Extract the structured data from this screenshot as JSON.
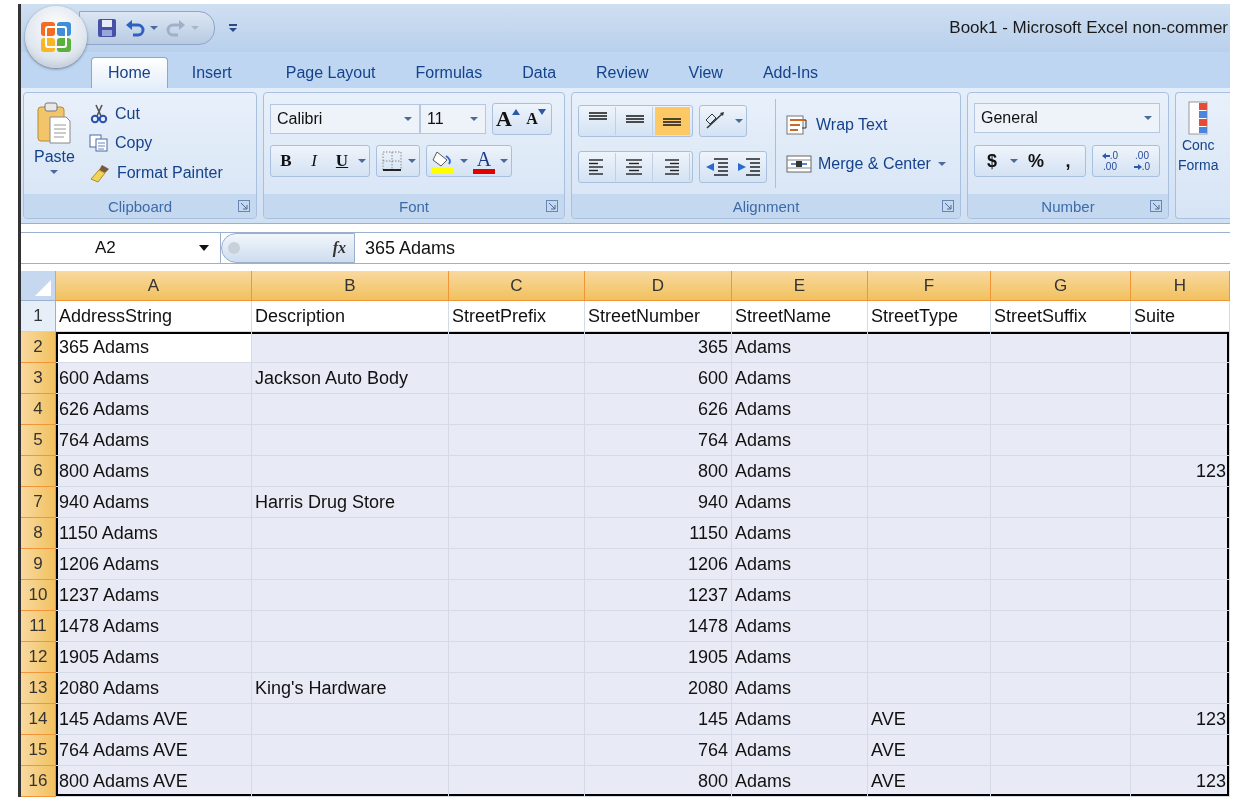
{
  "window": {
    "title": "Book1  -  Microsoft Excel non-commer"
  },
  "tabs": [
    {
      "label": "Home",
      "selected": true
    },
    {
      "label": "Insert",
      "selected": false
    },
    {
      "label": "Page Layout",
      "selected": false
    },
    {
      "label": "Formulas",
      "selected": false
    },
    {
      "label": "Data",
      "selected": false
    },
    {
      "label": "Review",
      "selected": false
    },
    {
      "label": "View",
      "selected": false
    },
    {
      "label": "Add-Ins",
      "selected": false
    }
  ],
  "ribbon": {
    "clipboard": {
      "label": "Clipboard",
      "paste": "Paste",
      "cut": "Cut",
      "copy": "Copy",
      "format_painter": "Format Painter"
    },
    "font": {
      "label": "Font",
      "font_name": "Calibri",
      "font_size": "11",
      "grow": "A",
      "shrink": "A",
      "bold": "B",
      "italic": "I",
      "underline": "U",
      "font_color": "A"
    },
    "alignment": {
      "label": "Alignment",
      "wrap_text": "Wrap Text",
      "merge_center": "Merge & Center",
      "vertical": [
        {
          "kind": "top",
          "selected": false
        },
        {
          "kind": "middle",
          "selected": false
        },
        {
          "kind": "bottom",
          "selected": true
        }
      ],
      "horizontal": [
        {
          "kind": "left",
          "selected": false
        },
        {
          "kind": "center",
          "selected": false
        },
        {
          "kind": "right",
          "selected": false
        }
      ]
    },
    "number": {
      "label": "Number",
      "format": "General",
      "currency": "$",
      "percent": "%",
      "comma": ",",
      "increase_decimal": [
        ".0",
        ".00"
      ],
      "decrease_decimal": [
        ".00",
        ".0"
      ]
    },
    "styles": {
      "conditional_formatting": [
        "Conc",
        "Forma"
      ]
    }
  },
  "formula_bar": {
    "name_box": "A2",
    "fx": "fx",
    "value": "365 Adams"
  },
  "sheet": {
    "columns": [
      {
        "letter": "A",
        "selected": true,
        "kind": "text"
      },
      {
        "letter": "B",
        "selected": true,
        "kind": "text"
      },
      {
        "letter": "C",
        "selected": true,
        "kind": "text"
      },
      {
        "letter": "D",
        "selected": true,
        "kind": "number"
      },
      {
        "letter": "E",
        "selected": true,
        "kind": "text"
      },
      {
        "letter": "F",
        "selected": true,
        "kind": "text"
      },
      {
        "letter": "G",
        "selected": true,
        "kind": "text"
      },
      {
        "letter": "H",
        "selected": true,
        "kind": "number"
      }
    ],
    "first_row": {
      "number": "1",
      "selected": false,
      "cells": [
        "AddressString",
        "Description",
        "StreetPrefix",
        "StreetNumber",
        "StreetName",
        "StreetType",
        "StreetSuffix",
        "Suite"
      ]
    },
    "rows": [
      {
        "number": "2",
        "selected": true,
        "active_first_cell": true,
        "cells": [
          "365 Adams",
          null,
          null,
          "365",
          "Adams",
          null,
          null,
          null
        ]
      },
      {
        "number": "3",
        "selected": true,
        "active_first_cell": false,
        "cells": [
          "600 Adams",
          "Jackson Auto Body",
          null,
          "600",
          "Adams",
          null,
          null,
          null
        ]
      },
      {
        "number": "4",
        "selected": true,
        "active_first_cell": false,
        "cells": [
          "626 Adams",
          null,
          null,
          "626",
          "Adams",
          null,
          null,
          null
        ]
      },
      {
        "number": "5",
        "selected": true,
        "active_first_cell": false,
        "cells": [
          "764 Adams",
          null,
          null,
          "764",
          "Adams",
          null,
          null,
          null
        ]
      },
      {
        "number": "6",
        "selected": true,
        "active_first_cell": false,
        "cells": [
          "800 Adams",
          null,
          null,
          "800",
          "Adams",
          null,
          null,
          "123"
        ]
      },
      {
        "number": "7",
        "selected": true,
        "active_first_cell": false,
        "cells": [
          "940 Adams",
          "Harris Drug Store",
          null,
          "940",
          "Adams",
          null,
          null,
          null
        ]
      },
      {
        "number": "8",
        "selected": true,
        "active_first_cell": false,
        "cells": [
          "1150 Adams",
          null,
          null,
          "1150",
          "Adams",
          null,
          null,
          null
        ]
      },
      {
        "number": "9",
        "selected": true,
        "active_first_cell": false,
        "cells": [
          "1206 Adams",
          null,
          null,
          "1206",
          "Adams",
          null,
          null,
          null
        ]
      },
      {
        "number": "10",
        "selected": true,
        "active_first_cell": false,
        "cells": [
          "1237 Adams",
          null,
          null,
          "1237",
          "Adams",
          null,
          null,
          null
        ]
      },
      {
        "number": "11",
        "selected": true,
        "active_first_cell": false,
        "cells": [
          "1478 Adams",
          null,
          null,
          "1478",
          "Adams",
          null,
          null,
          null
        ]
      },
      {
        "number": "12",
        "selected": true,
        "active_first_cell": false,
        "cells": [
          "1905 Adams",
          null,
          null,
          "1905",
          "Adams",
          null,
          null,
          null
        ]
      },
      {
        "number": "13",
        "selected": true,
        "active_first_cell": false,
        "cells": [
          "2080 Adams",
          "King's Hardware",
          null,
          "2080",
          "Adams",
          null,
          null,
          null
        ]
      },
      {
        "number": "14",
        "selected": true,
        "active_first_cell": false,
        "cells": [
          "145 Adams AVE",
          null,
          null,
          "145",
          "Adams",
          "AVE",
          null,
          "123"
        ]
      },
      {
        "number": "15",
        "selected": true,
        "active_first_cell": false,
        "cells": [
          "764 Adams AVE",
          null,
          null,
          "764",
          "Adams",
          "AVE",
          null,
          null
        ]
      },
      {
        "number": "16",
        "selected": true,
        "active_first_cell": false,
        "cells": [
          "800 Adams AVE",
          null,
          null,
          "800",
          "Adams",
          "AVE",
          null,
          "123"
        ]
      }
    ]
  }
}
